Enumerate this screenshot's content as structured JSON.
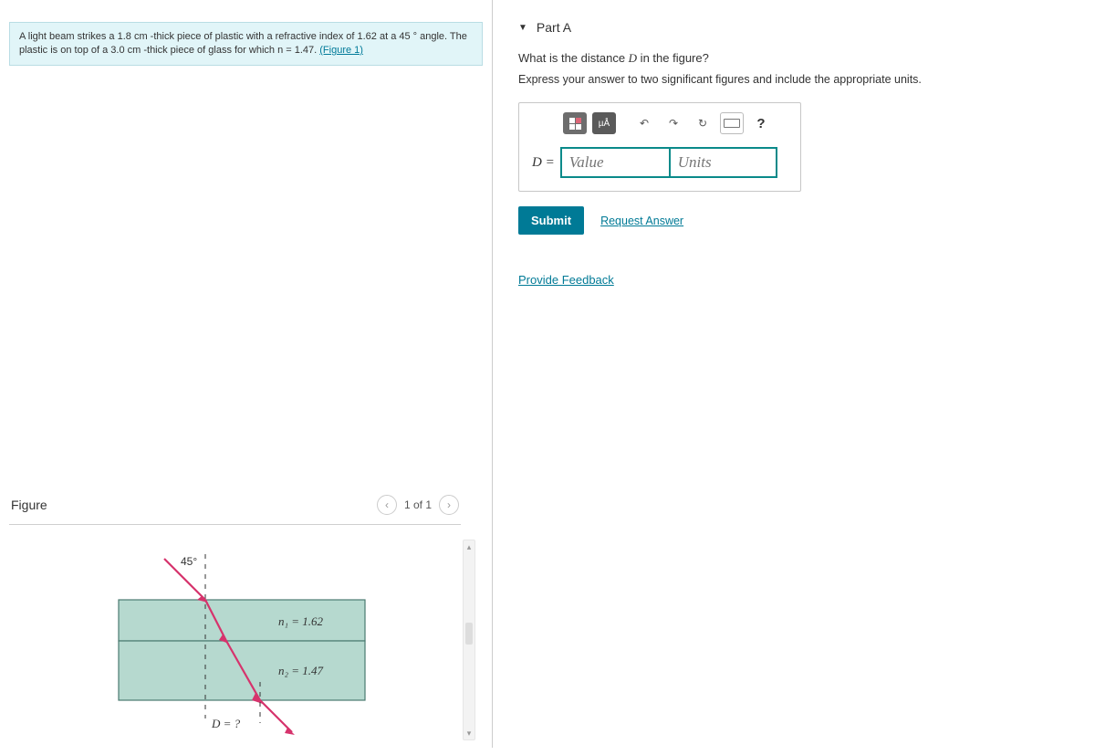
{
  "problem": {
    "text_before_link": "A light beam strikes a 1.8 cm -thick piece of plastic with a refractive index of 1.62 at a 45 ° angle. The plastic is on top of a 3.0 cm -thick piece of glass for which n = 1.47.",
    "figure_link": "(Figure 1)"
  },
  "figure": {
    "title": "Figure",
    "counter": "1 of 1",
    "labels": {
      "angle": "45°",
      "n1": "n₁ = 1.62",
      "n2": "n₂ = 1.47",
      "D": "D = ?"
    }
  },
  "part": {
    "header": "Part A",
    "question_prefix": "What is the distance ",
    "question_var": "D",
    "question_suffix": " in the figure?",
    "instructions": "Express your answer to two significant figures and include the appropriate units.",
    "toolbar": {
      "templates_hint": "templates",
      "symbols_hint": "µÅ",
      "undo_hint": "↶",
      "redo_hint": "↷",
      "reset_hint": "↻",
      "keyboard_hint": "keyboard",
      "help_hint": "?"
    },
    "answer": {
      "variable": "D =",
      "value_placeholder": "Value",
      "units_placeholder": "Units"
    },
    "submit_label": "Submit",
    "request_answer_label": "Request Answer"
  },
  "feedback_link": "Provide Feedback"
}
